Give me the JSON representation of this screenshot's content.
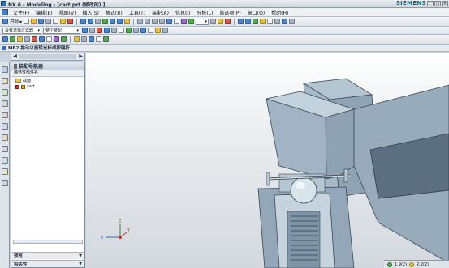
{
  "window": {
    "title": "NX 6 - Modeling - [cart.prt  (修改的)  ]",
    "brand": "SIEMENS",
    "controls": [
      "_",
      "□",
      "×"
    ]
  },
  "menubar": {
    "items": [
      "文件(F)",
      "编辑(E)",
      "视图(V)",
      "插入(S)",
      "格式(R)",
      "工具(T)",
      "装配(A)",
      "信息(I)",
      "分析(L)",
      "首选项(P)",
      "窗口(O)",
      "帮助(H)"
    ]
  },
  "toolbar1": {
    "start_label": "开始▾"
  },
  "toolbar2": {
    "filter_select": "没有选择过滤器",
    "assembly_select": "整个装配"
  },
  "cue_line": {
    "text": "MB2 拖动以旋转光标或按键折"
  },
  "navigator": {
    "title": "装配导航器",
    "column_header": "描述性部件名",
    "rows": [
      {
        "label": "截面",
        "type": "folder"
      },
      {
        "label": "cart",
        "type": "part"
      }
    ],
    "sections": [
      "预览",
      "相关性"
    ]
  },
  "status": {
    "value1": "1.9(2)",
    "value2": "2.2(2)"
  },
  "axes": {
    "x": "X",
    "y": "Y",
    "z": "Z"
  },
  "colors": {
    "part_body": "#9fb3c3",
    "part_shadow": "#5b6f80",
    "viewport_bg": "#e4e8ec",
    "accent": "#2f6fb8"
  }
}
